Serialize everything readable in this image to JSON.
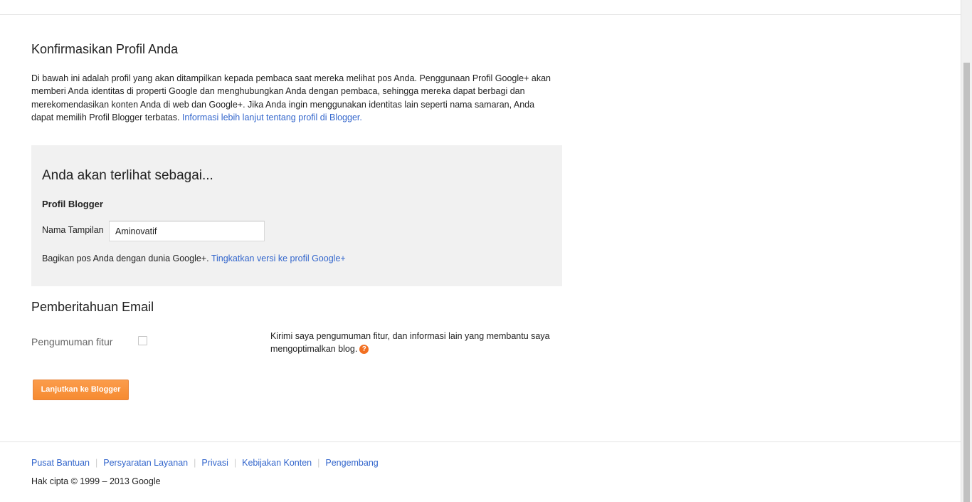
{
  "page": {
    "title": "Konfirmasikan Profil Anda",
    "intro_text": "Di bawah ini adalah profil yang akan ditampilkan kepada pembaca saat mereka melihat pos Anda. Penggunaan Profil Google+ akan memberi Anda identitas di properti Google dan menghubungkan Anda dengan pembaca, sehingga mereka dapat berbagi dan merekomendasikan konten Anda di web dan Google+. Jika Anda ingin menggunakan identitas lain seperti nama samaran, Anda dapat memilih Profil Blogger terbatas.",
    "intro_link": "Informasi lebih lanjut tentang profil di Blogger."
  },
  "profile_box": {
    "title": "Anda akan terlihat sebagai...",
    "profile_type": "Profil Blogger",
    "display_name_label": "Nama Tampilan",
    "display_name_value": "Aminovatif",
    "share_text": "Bagikan pos Anda dengan dunia Google+.",
    "upgrade_link": "Tingkatkan versi ke profil Google+"
  },
  "email_notifications": {
    "title": "Pemberitahuan Email",
    "feature_label": "Pengumuman fitur",
    "feature_checked": false,
    "feature_description": "Kirimi saya pengumuman fitur, dan informasi lain yang membantu saya mengoptimalkan blog.",
    "help_icon": "question-mark-icon",
    "help_glyph": "?"
  },
  "continue_button": {
    "label": "Lanjutkan ke Blogger",
    "color": "#f68b31"
  },
  "footer": {
    "links": [
      "Pusat Bantuan",
      "Persyaratan Layanan",
      "Privasi",
      "Kebijakan Konten",
      "Pengembang"
    ],
    "separator": "|",
    "copyright": "Hak cipta © 1999 – 2013 Google"
  },
  "colors": {
    "link": "#3366cc",
    "box_background": "#f1f1f1",
    "accent": "#f26f21"
  }
}
